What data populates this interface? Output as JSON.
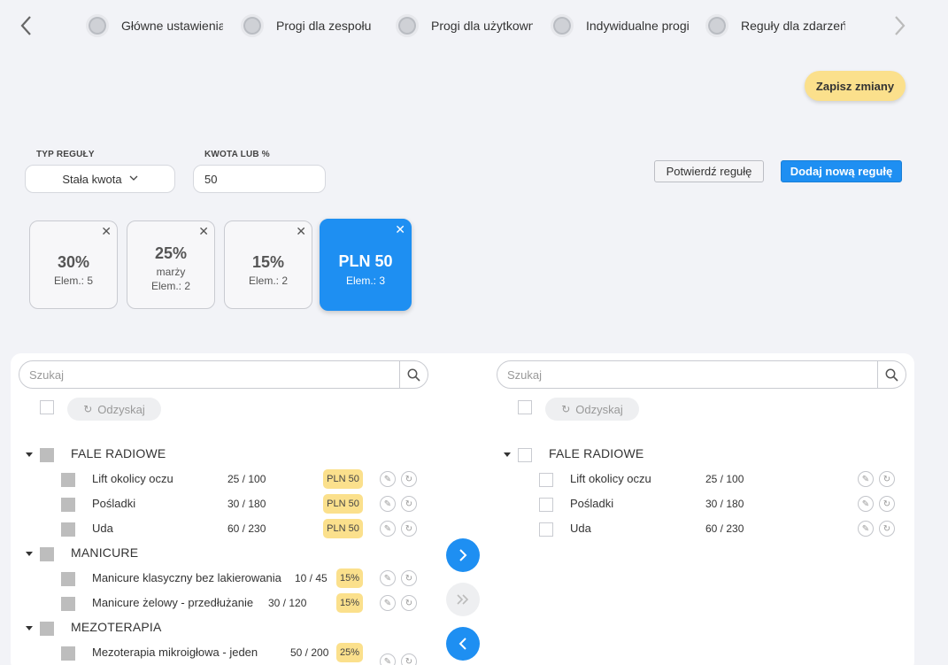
{
  "stepper": {
    "steps": [
      {
        "label": "Główne ustawienia"
      },
      {
        "label": "Progi dla zespołu"
      },
      {
        "label": "Progi dla użytkowników"
      },
      {
        "label": "Indywidualne progi"
      },
      {
        "label": "Reguły dla zdarzeń"
      }
    ]
  },
  "save_label": "Zapisz zmiany",
  "form": {
    "rule_type_label": "TYP REGUŁY",
    "rule_type_value": "Stała kwota",
    "amount_label": "KWOTA LUB %",
    "amount_value": "50",
    "confirm_label": "Potwierdź regułę",
    "add_label": "Dodaj nową regułę"
  },
  "rules": [
    {
      "value": "30%",
      "extra": "",
      "count": "Elem.: 5"
    },
    {
      "value": "25%",
      "extra": "marży",
      "count": "Elem.: 2"
    },
    {
      "value": "15%",
      "extra": "",
      "count": "Elem.: 2"
    },
    {
      "value": "PLN 50",
      "extra": "",
      "count": "Elem.: 3"
    }
  ],
  "left": {
    "search_placeholder": "Szukaj",
    "restore_label": "Odzyskaj",
    "groups": [
      {
        "name": "FALE RADIOWE",
        "items": [
          {
            "name": "Lift okolicy oczu",
            "ratio": "25  /  100",
            "badge": "PLN 50"
          },
          {
            "name": "Pośladki",
            "ratio": "30  /  180",
            "badge": "PLN 50"
          },
          {
            "name": "Uda",
            "ratio": "60  /  230",
            "badge": "PLN 50"
          }
        ]
      },
      {
        "name": "MANICURE",
        "items": [
          {
            "name": "Manicure klasyczny bez lakierowania",
            "ratio": "10  /  45",
            "badge": "15%"
          },
          {
            "name": "Manicure żelowy - przedłużanie",
            "ratio": "30  /  120",
            "badge": "15%"
          }
        ]
      },
      {
        "name": "MEZOTERAPIA",
        "items": [
          {
            "name": "Mezoterapia mikroigłowa - jeden",
            "ratio": "50  /  200",
            "badge": "25%"
          }
        ]
      }
    ]
  },
  "right": {
    "search_placeholder": "Szukaj",
    "restore_label": "Odzyskaj",
    "groups": [
      {
        "name": "FALE RADIOWE",
        "items": [
          {
            "name": "Lift okolicy oczu",
            "ratio": "25  /  100"
          },
          {
            "name": "Pośladki",
            "ratio": "30  /  180"
          },
          {
            "name": "Uda",
            "ratio": "60  /  230"
          }
        ]
      }
    ]
  },
  "colors": {
    "accent": "#1e8ff2",
    "badge": "#fbe08c",
    "background": "#f2f3f7"
  },
  "icons": [
    "chevron-left-icon",
    "chevron-right-icon",
    "search-icon",
    "refresh-icon",
    "pencil-icon",
    "close-icon",
    "double-chevron-right-icon"
  ]
}
